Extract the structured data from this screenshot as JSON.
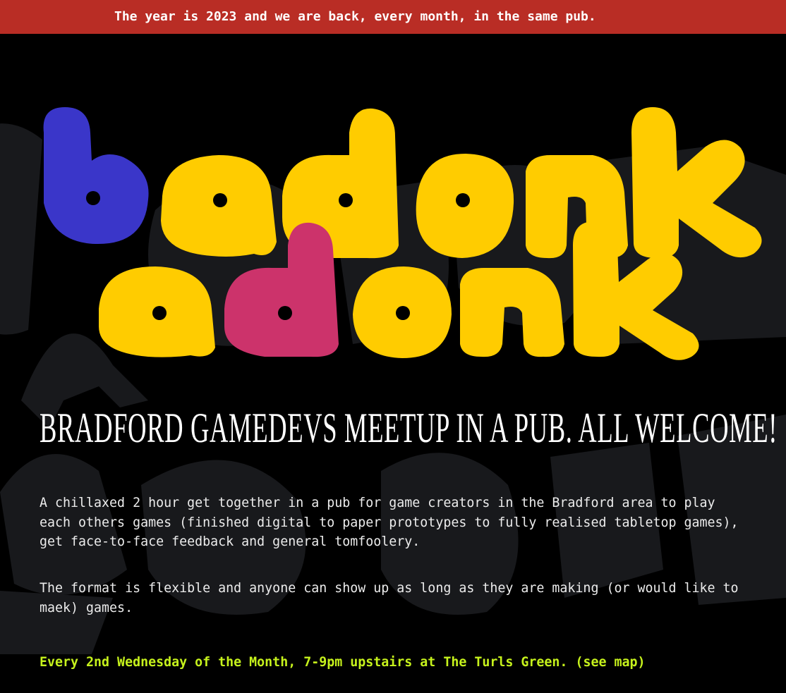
{
  "banner": {
    "text": "The year is 2023 and we are back, every month, in the same pub."
  },
  "logo": {
    "line1": "badonk",
    "line2": "adonk",
    "colors": {
      "blue": "#3a36c9",
      "yellow": "#ffcc00",
      "pink": "#cc336b",
      "background_watermark": "#18191c"
    }
  },
  "main": {
    "headline": "BRADFORD GAMEDEVS MEETUP IN A PUB. ALL WELCOME!",
    "paragraph1": "A chillaxed 2 hour get together in a pub for game creators in the Bradford area to play each others games (finished digital to paper prototypes to fully realised tabletop games), get face-to-face feedback and general tomfoolery.",
    "paragraph2": "The format is flexible and anyone can show up as long as they are making (or would like to maek) games.",
    "schedule_text": "Every 2nd Wednesday of the Month, 7-9pm upstairs at The Turls Green.",
    "map_link": "(see map)"
  },
  "colors": {
    "banner_bg": "#b92d25",
    "page_bg": "#000000",
    "schedule_accent": "#c6f21c"
  }
}
